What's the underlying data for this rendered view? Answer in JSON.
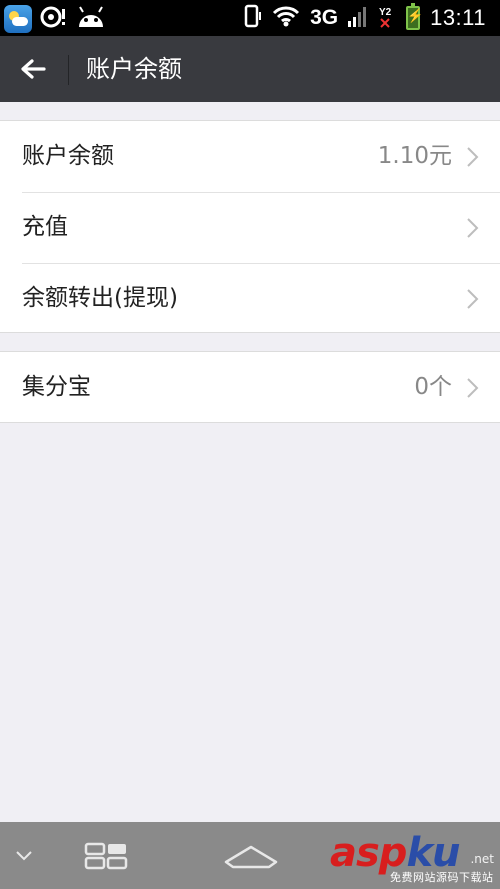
{
  "status_bar": {
    "network": "3G",
    "time": "13:11"
  },
  "header": {
    "title": "账户余额"
  },
  "groups": [
    {
      "rows": [
        {
          "label": "账户余额",
          "value": "1.10元"
        },
        {
          "label": "充值",
          "value": ""
        },
        {
          "label": "余额转出(提现)",
          "value": ""
        }
      ]
    },
    {
      "rows": [
        {
          "label": "集分宝",
          "value": "0个"
        }
      ]
    }
  ],
  "watermark": {
    "brand_a": "asp",
    "brand_b": "ku",
    "domain": ".net",
    "tagline": "免费网站源码下载站"
  },
  "icons": {
    "back": "arrow-left-icon",
    "row_chevron": "chevron-right-icon",
    "nav": [
      "chevron-down-icon",
      "recent-apps-icon",
      "home-icon"
    ]
  },
  "colors": {
    "titlebar": "#393a3f",
    "background": "#f0eff4",
    "navbar": "#8a8a8a"
  }
}
